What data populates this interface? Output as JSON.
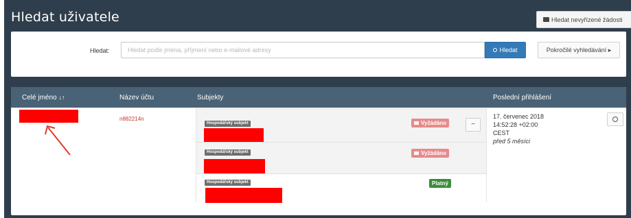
{
  "header": {
    "title": "Hledat uživatele",
    "pending_button": "Hledat nevyřízené žádosti"
  },
  "search": {
    "label": "Hledat:",
    "placeholder": "Hledat podle jména, příjmení nebo e-mailové adresy",
    "button": "Hledat",
    "advanced_button": "Pokročilé vyhledávání ▸"
  },
  "table": {
    "columns": [
      "Celé jméno",
      "Název účtu",
      "Subjekty",
      "Poslední přihlášení"
    ],
    "sort_icon": "↓↑",
    "row": {
      "account": "n882214n",
      "subjects": [
        {
          "tag": "Hospodářský subjekt",
          "status": "Vyžádáno",
          "status_type": "requested"
        },
        {
          "tag": "Hospodářský subjekt",
          "status": "Vyžádáno",
          "status_type": "requested"
        },
        {
          "tag": "Hospodářský subjekt",
          "status": "Platný",
          "status_type": "valid"
        }
      ],
      "collapse_label": "−",
      "last_login": {
        "date": "17. červenec 2018",
        "time": "14:52:28 +02:00",
        "tz": "CEST",
        "ago": "před 5 měsíci"
      }
    }
  },
  "colors": {
    "background": "#2f3e4c",
    "header": "#4a6275",
    "primary": "#337ab7",
    "requested": "#e88a8a",
    "valid": "#3c8d3c",
    "redaction": "#ff0000"
  },
  "icons": [
    "flag-icon",
    "search-icon",
    "sort-icon",
    "clock-icon",
    "arrow-annotation"
  ]
}
